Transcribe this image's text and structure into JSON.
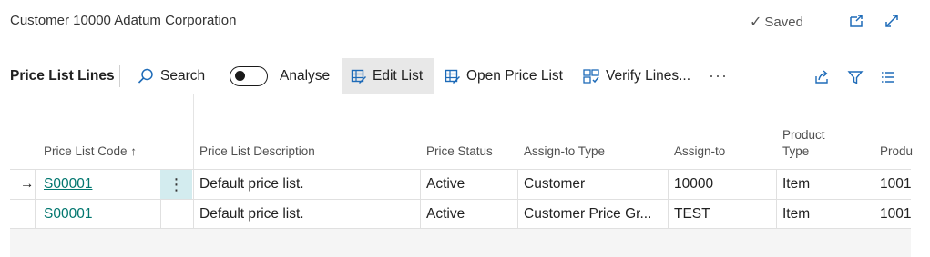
{
  "window": {
    "title": "Customer 10000 Adatum Corporation",
    "status": "Saved",
    "icons": [
      "open-new-window-icon",
      "expand-icon"
    ]
  },
  "actionbar": {
    "page_title": "Price List Lines",
    "search_label": "Search",
    "analyse_label": "Analyse",
    "analyse_on": false,
    "edit_list_label": "Edit List",
    "open_price_list_label": "Open Price List",
    "verify_lines_label": "Verify Lines...",
    "more_label": "···",
    "right_icons": [
      "share-icon",
      "filter-icon",
      "list-view-icon"
    ]
  },
  "table": {
    "headers": {
      "code": "Price List Code ↑",
      "description": "Price List Description",
      "status": "Price Status",
      "assign_type": "Assign-to Type",
      "assign_to": "Assign-to",
      "product_type_line1": "Product",
      "product_type_line2": "Type",
      "product_no": "Produ"
    },
    "rows": [
      {
        "indicator": "→",
        "code": "S00001",
        "description": "Default price list.",
        "status": "Active",
        "assign_type": "Customer",
        "assign_to": "10000",
        "product_type": "Item",
        "product_no": "1001"
      },
      {
        "indicator": "",
        "code": "S00001",
        "description": "Default price list.",
        "status": "Active",
        "assign_type": "Customer Price Gr...",
        "assign_to": "TEST",
        "product_type": "Item",
        "product_no": "1001"
      }
    ]
  },
  "colors": {
    "link": "#00766e",
    "selected_cell": "#d3ecef",
    "active_button": "#e8e8e8",
    "icon_blue": "#2b6cb0"
  }
}
